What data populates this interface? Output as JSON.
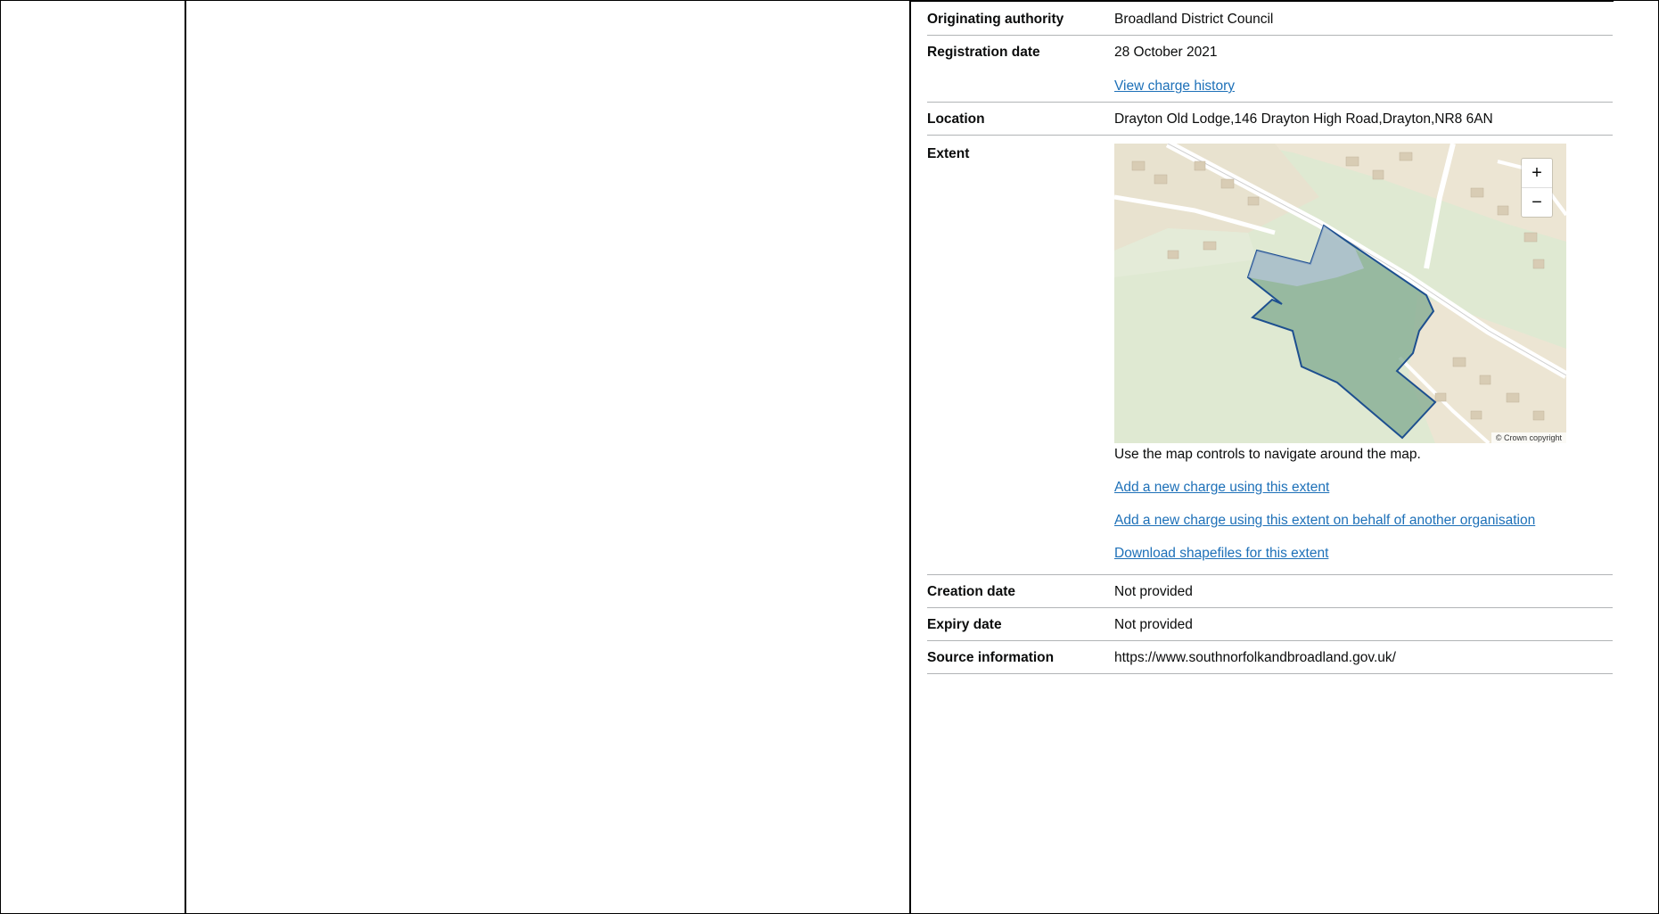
{
  "summary": {
    "rows": [
      {
        "key": "Originating authority",
        "value": "Broadland District Council"
      },
      {
        "key": "Registration date",
        "value": "28 October 2021",
        "link": "View charge history"
      },
      {
        "key": "Location",
        "value": "Drayton Old Lodge,146 Drayton High Road,Drayton,NR8 6AN"
      },
      {
        "key": "Extent"
      },
      {
        "key": "Creation date",
        "value": "Not provided"
      },
      {
        "key": "Expiry date",
        "value": "Not provided"
      },
      {
        "key": "Source information",
        "value": "https://www.southnorfolkandbroadland.gov.uk/"
      }
    ]
  },
  "map": {
    "zoom_in": "+",
    "zoom_out": "−",
    "attribution": "© Crown copyright",
    "help_text": "Use the map controls to navigate around the map.",
    "links": [
      "Add a new charge using this extent",
      "Add a new charge using this extent on behalf of another organisation",
      "Download shapefiles for this extent"
    ],
    "colors": {
      "boundary": "#1d4f8f",
      "fill": "#7fa88f",
      "land": "#dfe9d2"
    }
  }
}
